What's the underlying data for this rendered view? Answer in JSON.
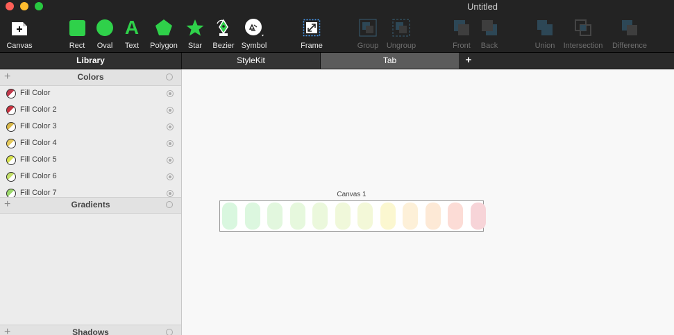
{
  "window": {
    "title": "Untitled"
  },
  "toolbar": {
    "canvas": "Canvas",
    "rect": "Rect",
    "oval": "Oval",
    "text": "Text",
    "text_glyph": "A",
    "polygon": "Polygon",
    "star": "Star",
    "bezier": "Bezier",
    "symbol": "Symbol",
    "frame": "Frame",
    "group": "Group",
    "ungroup": "Ungroup",
    "front": "Front",
    "back": "Back",
    "union": "Union",
    "intersection": "Intersection",
    "difference": "Difference",
    "accent_color": "#2fd14a"
  },
  "tabs": {
    "library": "Library",
    "stylekit": "StyleKit",
    "tab": "Tab",
    "add": "+"
  },
  "sidebar": {
    "colors_header": "Colors",
    "gradients_header": "Gradients",
    "shadows_header": "Shadows",
    "plus": "+",
    "colors": [
      {
        "name": "Fill Color",
        "swatch": "#c0394b"
      },
      {
        "name": "Fill Color 2",
        "swatch": "#c8323f"
      },
      {
        "name": "Fill Color 3",
        "swatch": "#d9b84a"
      },
      {
        "name": "Fill Color 4",
        "swatch": "#e5c95a"
      },
      {
        "name": "Fill Color 5",
        "swatch": "#d8e24d"
      },
      {
        "name": "Fill Color 6",
        "swatch": "#c4e06a"
      },
      {
        "name": "Fill Color 7",
        "swatch": "#9bd86a"
      }
    ]
  },
  "canvas": {
    "label": "Canvas 1",
    "pill_colors": [
      "#d9f7df",
      "#dcf7df",
      "#e2f7de",
      "#e6f8dd",
      "#ebf8dc",
      "#f0f8da",
      "#f3f8d8",
      "#fbf7d0",
      "#fdf0d8",
      "#fde9d6",
      "#fcdcd6",
      "#f7d4d8"
    ]
  }
}
